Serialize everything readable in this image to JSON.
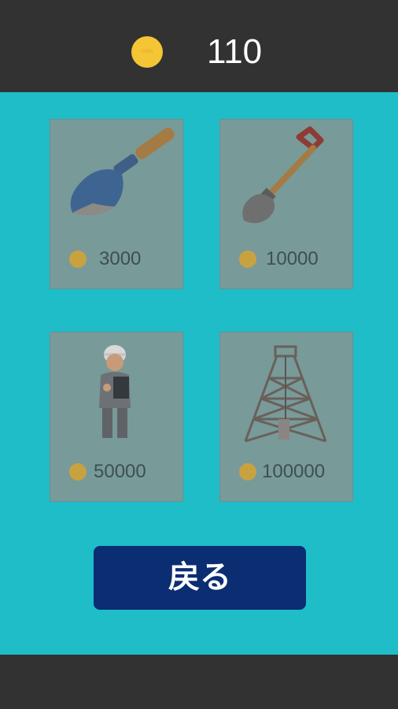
{
  "header": {
    "coin_icon": "coin-icon",
    "coin_label": "coin",
    "coin_count": "110"
  },
  "shop": {
    "items": [
      {
        "icon": "trowel-icon",
        "price": "3000"
      },
      {
        "icon": "shovel-icon",
        "price": "10000"
      },
      {
        "icon": "worker-icon",
        "price": "50000"
      },
      {
        "icon": "drilling-tower-icon",
        "price": "100000"
      }
    ]
  },
  "back_button": {
    "label": "戻る"
  },
  "colors": {
    "background": "#1fbdc8",
    "bar": "#323232",
    "card": "#789a99",
    "coin": "#f4c534",
    "button": "#0b2d72"
  }
}
